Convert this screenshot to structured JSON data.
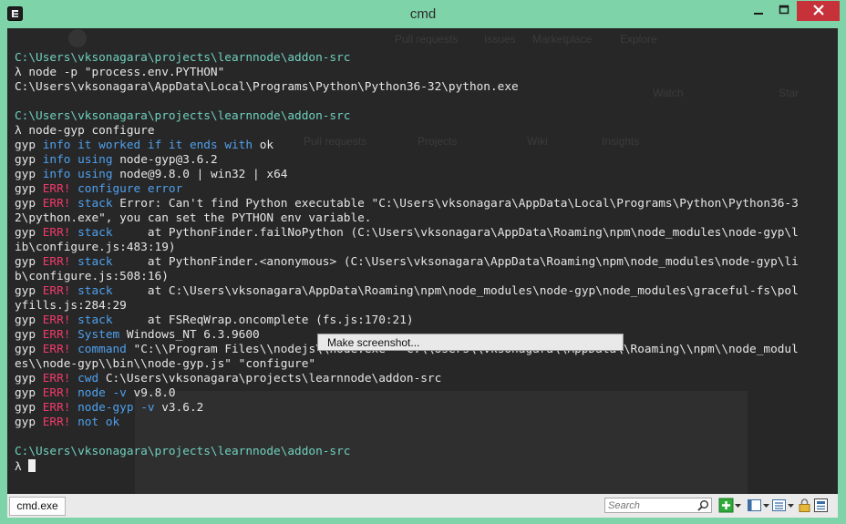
{
  "window": {
    "title": "cmd"
  },
  "background_ghost": {
    "nav": [
      "Pull requests",
      "Issues",
      "Marketplace",
      "Explore"
    ],
    "watch": "Watch",
    "star": "Star",
    "tabs": [
      "Pull requests",
      "Projects",
      "Wiki",
      "Insights"
    ]
  },
  "terminal": {
    "lines": [
      [
        {
          "t": "C:\\Users\\vksonagara\\projects\\learnnode\\addon-src",
          "c": "path"
        }
      ],
      [
        {
          "t": "λ node -p \"process.env.PYTHON\""
        }
      ],
      [
        {
          "t": "C:\\Users\\vksonagara\\AppData\\Local\\Programs\\Python\\Python36-32\\python.exe"
        }
      ],
      [],
      [
        {
          "t": "C:\\Users\\vksonagara\\projects\\learnnode\\addon-src",
          "c": "path"
        }
      ],
      [
        {
          "t": "λ node-gyp configure"
        }
      ],
      [
        {
          "t": "gyp "
        },
        {
          "t": "info",
          "c": "info"
        },
        {
          "t": " "
        },
        {
          "t": "it worked if it ends with",
          "c": "kw"
        },
        {
          "t": " ok"
        }
      ],
      [
        {
          "t": "gyp "
        },
        {
          "t": "info",
          "c": "info"
        },
        {
          "t": " "
        },
        {
          "t": "using",
          "c": "kw"
        },
        {
          "t": " node-gyp@3.6.2"
        }
      ],
      [
        {
          "t": "gyp "
        },
        {
          "t": "info",
          "c": "info"
        },
        {
          "t": " "
        },
        {
          "t": "using",
          "c": "kw"
        },
        {
          "t": " node@9.8.0 | win32 | x64"
        }
      ],
      [
        {
          "t": "gyp "
        },
        {
          "t": "ERR!",
          "c": "err"
        },
        {
          "t": " "
        },
        {
          "t": "configure error",
          "c": "kw"
        }
      ],
      [
        {
          "t": "gyp "
        },
        {
          "t": "ERR!",
          "c": "err"
        },
        {
          "t": " "
        },
        {
          "t": "stack",
          "c": "kw"
        },
        {
          "t": " Error: Can't find Python executable \"C:\\Users\\vksonagara\\AppData\\Local\\Programs\\Python\\Python36-3"
        }
      ],
      [
        {
          "t": "2\\python.exe\", you can set the PYTHON env variable."
        }
      ],
      [
        {
          "t": "gyp "
        },
        {
          "t": "ERR!",
          "c": "err"
        },
        {
          "t": " "
        },
        {
          "t": "stack",
          "c": "kw"
        },
        {
          "t": "     at PythonFinder.failNoPython (C:\\Users\\vksonagara\\AppData\\Roaming\\npm\\node_modules\\node-gyp\\l"
        }
      ],
      [
        {
          "t": "ib\\configure.js:483:19)"
        }
      ],
      [
        {
          "t": "gyp "
        },
        {
          "t": "ERR!",
          "c": "err"
        },
        {
          "t": " "
        },
        {
          "t": "stack",
          "c": "kw"
        },
        {
          "t": "     at PythonFinder.<anonymous> (C:\\Users\\vksonagara\\AppData\\Roaming\\npm\\node_modules\\node-gyp\\li"
        }
      ],
      [
        {
          "t": "b\\configure.js:508:16)"
        }
      ],
      [
        {
          "t": "gyp "
        },
        {
          "t": "ERR!",
          "c": "err"
        },
        {
          "t": " "
        },
        {
          "t": "stack",
          "c": "kw"
        },
        {
          "t": "     at C:\\Users\\vksonagara\\AppData\\Roaming\\npm\\node_modules\\node-gyp\\node_modules\\graceful-fs\\pol"
        }
      ],
      [
        {
          "t": "yfills.js:284:29"
        }
      ],
      [
        {
          "t": "gyp "
        },
        {
          "t": "ERR!",
          "c": "err"
        },
        {
          "t": " "
        },
        {
          "t": "stack",
          "c": "kw"
        },
        {
          "t": "     at FSReqWrap.oncomplete (fs.js:170:21)"
        }
      ],
      [
        {
          "t": "gyp "
        },
        {
          "t": "ERR!",
          "c": "err"
        },
        {
          "t": " "
        },
        {
          "t": "System",
          "c": "kw"
        },
        {
          "t": " Windows_NT 6.3.9600"
        }
      ],
      [
        {
          "t": "gyp "
        },
        {
          "t": "ERR!",
          "c": "err"
        },
        {
          "t": " "
        },
        {
          "t": "command",
          "c": "kw"
        },
        {
          "t": " \"C:\\\\Program Files\\\\nodejs\\\\node.exe\" \"C:\\\\Users\\\\vksonagara\\\\AppData\\\\Roaming\\\\npm\\\\node_modul"
        }
      ],
      [
        {
          "t": "es\\\\node-gyp\\\\bin\\\\node-gyp.js\" \"configure\""
        }
      ],
      [
        {
          "t": "gyp "
        },
        {
          "t": "ERR!",
          "c": "err"
        },
        {
          "t": " "
        },
        {
          "t": "cwd",
          "c": "kw"
        },
        {
          "t": " C:\\Users\\vksonagara\\projects\\learnnode\\addon-src"
        }
      ],
      [
        {
          "t": "gyp "
        },
        {
          "t": "ERR!",
          "c": "err"
        },
        {
          "t": " "
        },
        {
          "t": "node -v",
          "c": "kw"
        },
        {
          "t": " v9.8.0"
        }
      ],
      [
        {
          "t": "gyp "
        },
        {
          "t": "ERR!",
          "c": "err"
        },
        {
          "t": " "
        },
        {
          "t": "node-gyp -v",
          "c": "kw"
        },
        {
          "t": " v3.6.2"
        }
      ],
      [
        {
          "t": "gyp "
        },
        {
          "t": "ERR!",
          "c": "err"
        },
        {
          "t": " "
        },
        {
          "t": "not ok",
          "c": "kw"
        }
      ],
      [],
      [
        {
          "t": "C:\\Users\\vksonagara\\projects\\learnnode\\addon-src",
          "c": "path"
        }
      ],
      [
        {
          "t": "λ "
        },
        {
          "t": "",
          "c": "cursor"
        }
      ]
    ]
  },
  "context_menu": {
    "item": "Make screenshot..."
  },
  "statusbar": {
    "tab_label": "cmd.exe",
    "search_placeholder": "Search"
  },
  "colors": {
    "frame": "#7fd3a8",
    "terminal_bg": "#272727",
    "path": "#6fd0be",
    "info": "#4fa0ee",
    "err": "#ee3a6a"
  }
}
